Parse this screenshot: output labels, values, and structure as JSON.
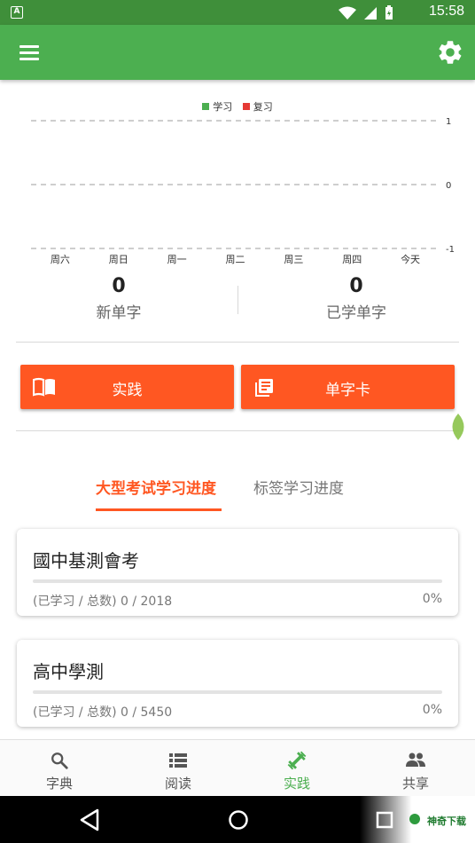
{
  "status_bar": {
    "time": "15:58",
    "notification_icon": "A"
  },
  "app_bar": {
    "menu_icon": "hamburger-menu-icon",
    "settings_icon": "gear-icon",
    "color": "#4caf50"
  },
  "chart_data": {
    "type": "bar",
    "legend": [
      "学习",
      "复习"
    ],
    "colors": [
      "#4caf50",
      "#e53935"
    ],
    "categories": [
      "周六",
      "周日",
      "周一",
      "周二",
      "周三",
      "周四",
      "今天"
    ],
    "series": [
      {
        "name": "学习",
        "values": [
          0,
          0,
          0,
          0,
          0,
          0,
          0
        ]
      },
      {
        "name": "复习",
        "values": [
          0,
          0,
          0,
          0,
          0,
          0,
          0
        ]
      }
    ],
    "yticks": [
      "1",
      "0",
      "-1"
    ],
    "ylim": [
      -1,
      1
    ],
    "grid": "dashed horizontal"
  },
  "stats": {
    "new": {
      "value": "0",
      "label": "新单字"
    },
    "learned": {
      "value": "0",
      "label": "已学单字"
    }
  },
  "actions": {
    "practice": {
      "label": "实践",
      "icon": "book-icon"
    },
    "flashcards": {
      "label": "单字卡",
      "icon": "card-library-icon"
    }
  },
  "tabs": [
    {
      "label": "大型考试学习进度",
      "active": true
    },
    {
      "label": "标签学习进度",
      "active": false
    }
  ],
  "progress_cards": [
    {
      "title": "國中基測會考",
      "progress_text": "(已学习 / 总数)  0 / 2018",
      "percent_text": "0%",
      "percent": 0
    },
    {
      "title": "高中學測",
      "progress_text": "(已学习 / 总数)  0 / 5450",
      "percent_text": "0%",
      "percent": 0
    }
  ],
  "bottom_nav": [
    {
      "label": "字典",
      "icon": "search-icon",
      "active": false
    },
    {
      "label": "阅读",
      "icon": "list-icon",
      "active": false
    },
    {
      "label": "实践",
      "icon": "dumbbell-icon",
      "active": true
    },
    {
      "label": "共享",
      "icon": "people-icon",
      "active": false
    }
  ],
  "watermark": {
    "text": "神奇下载"
  }
}
